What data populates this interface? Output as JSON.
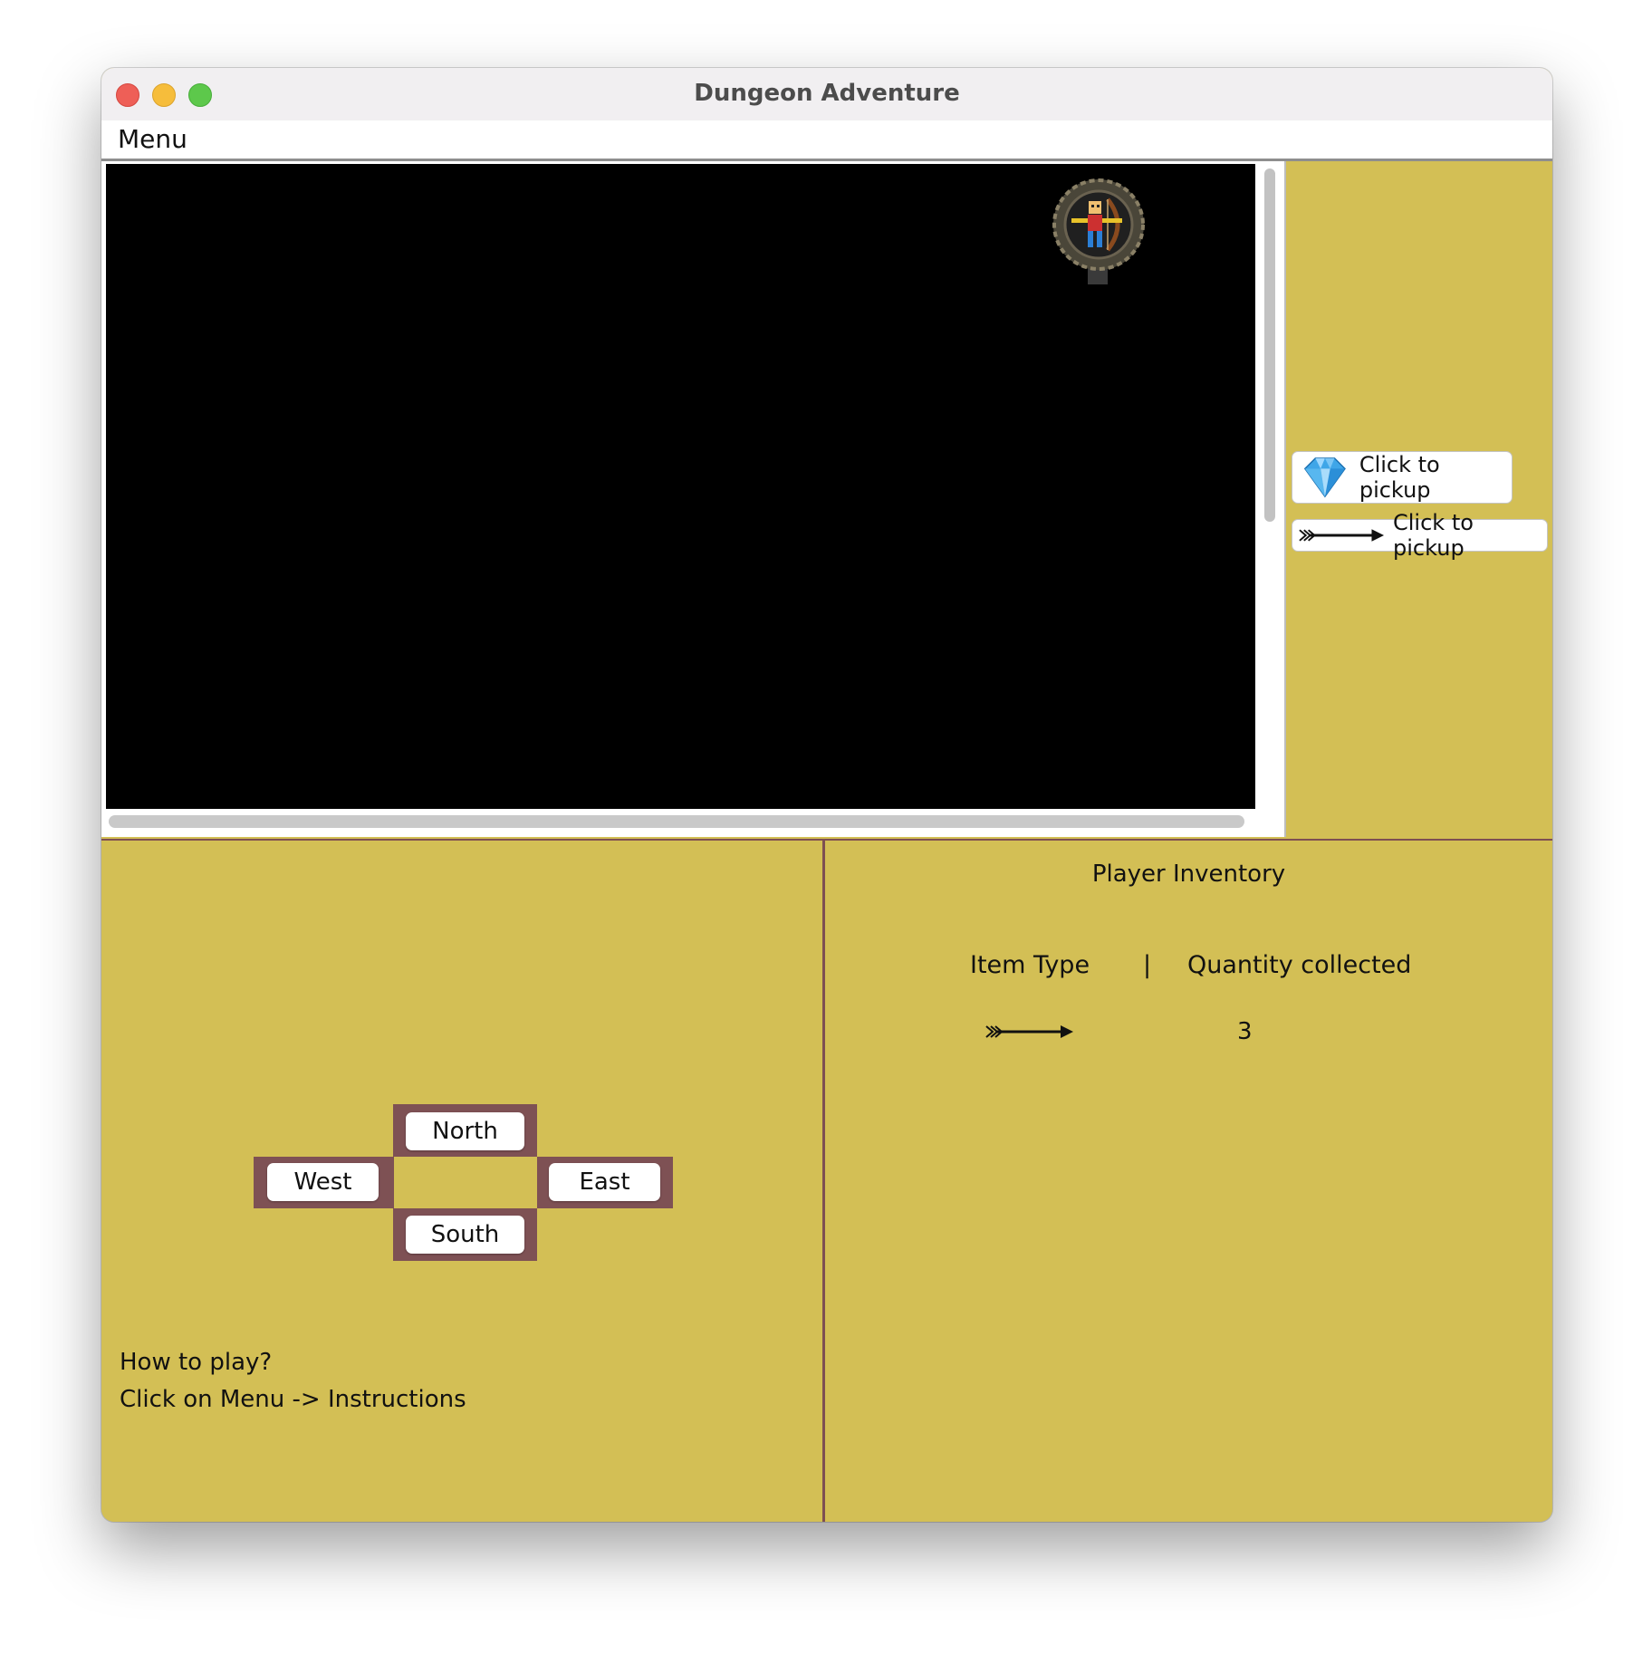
{
  "window": {
    "title": "Dungeon Adventure"
  },
  "menubar": {
    "menu_label": "Menu"
  },
  "pickups": [
    {
      "icon": "diamond-gem-icon",
      "label": "Click to pickup"
    },
    {
      "icon": "arrow-icon",
      "label": "Click to pickup"
    }
  ],
  "controls": {
    "north": "North",
    "west": "West",
    "east": "East",
    "south": "South"
  },
  "help": {
    "line1": "How to play?",
    "line2": "Click on Menu -> Instructions"
  },
  "inventory": {
    "title": "Player Inventory",
    "col_item": "Item Type",
    "separator": "|",
    "col_qty": "Quantity collected",
    "rows": [
      {
        "icon": "arrow-icon",
        "quantity": "3"
      }
    ]
  },
  "colors": {
    "panel": "#d3bf55",
    "border": "#7e4f52",
    "map_background": "#000000"
  }
}
